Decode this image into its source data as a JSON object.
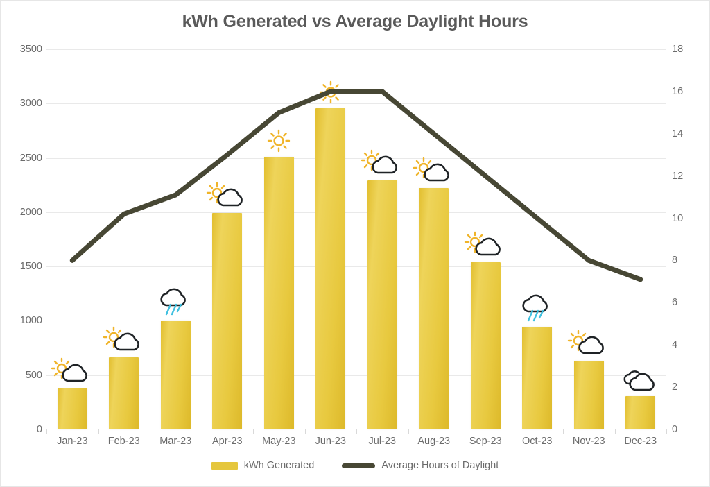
{
  "chart_data": {
    "type": "bar",
    "title": "kWh Generated vs Average Daylight Hours",
    "xlabel": "",
    "ylabel": "",
    "categories": [
      "Jan-23",
      "Feb-23",
      "Mar-23",
      "Apr-23",
      "May-23",
      "Jun-23",
      "Jul-23",
      "Aug-23",
      "Sep-23",
      "Oct-23",
      "Nov-23",
      "Dec-23"
    ],
    "series": [
      {
        "name": "kWh Generated",
        "type": "bar",
        "axis": "left",
        "color": "#e5c63c",
        "values": [
          380,
          665,
          1000,
          1990,
          2510,
          2955,
          2290,
          2220,
          1540,
          945,
          635,
          305
        ]
      },
      {
        "name": "Average Hours of Daylight",
        "type": "line",
        "axis": "right",
        "color": "#474734",
        "values": [
          8.0,
          10.2,
          11.1,
          13.0,
          15.0,
          16.0,
          16.0,
          14.0,
          12.0,
          10.0,
          8.0,
          7.1
        ]
      }
    ],
    "y_left_ticks": [
      0,
      500,
      1000,
      1500,
      2000,
      2500,
      3000,
      3500
    ],
    "y_left_lim": [
      0,
      3500
    ],
    "y_right_ticks": [
      0,
      2,
      4,
      6,
      8,
      10,
      12,
      14,
      16,
      18
    ],
    "y_right_lim": [
      0,
      18
    ],
    "grid": true,
    "legend_position": "bottom",
    "weather_icons": [
      "sun-cloud-icon",
      "sun-cloud-icon",
      "rain-cloud-icon",
      "sun-cloud-icon",
      "sun-icon",
      "sun-icon",
      "sun-cloud-icon",
      "sun-cloud-icon",
      "sun-cloud-icon",
      "rain-cloud-icon",
      "sun-cloud-icon",
      "double-cloud-icon"
    ],
    "colors": {
      "bar": "#e5c63c",
      "line": "#474734",
      "title_text": "#5a5a5a",
      "tick_text": "#6b6b6b",
      "gridline": "#e9e9e9",
      "rain": "#3fc0e0",
      "sun": "#f0b429",
      "cloud_outline": "#1f2326",
      "background": "#ffffff"
    }
  },
  "legend": {
    "items": [
      {
        "label": "kWh Generated"
      },
      {
        "label": "Average Hours of Daylight"
      }
    ]
  }
}
